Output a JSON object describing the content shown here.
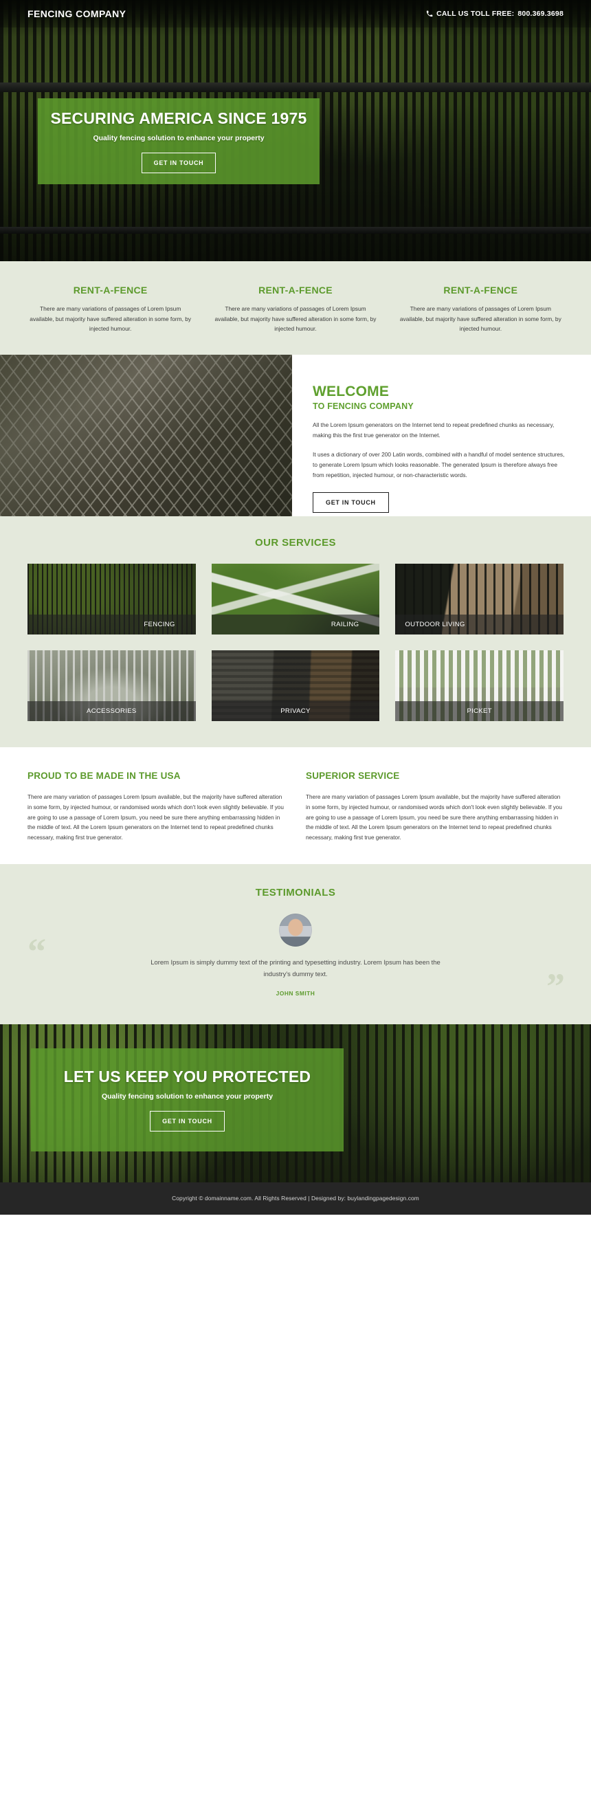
{
  "header": {
    "logo": "FENCING COMPANY",
    "phone_label": "CALL US TOLL FREE:",
    "phone_number": "800.369.3698",
    "phone_icon": "phone-icon"
  },
  "hero": {
    "title": "SECURING AMERICA SINCE 1975",
    "subtitle": "Quality fencing solution to enhance your property",
    "cta_label": "GET IN TOUCH"
  },
  "features": [
    {
      "title": "RENT-A-FENCE",
      "text": "There are many variations of passages of Lorem Ipsum available, but majority have suffered alteration in some form, by injected humour."
    },
    {
      "title": "RENT-A-FENCE",
      "text": "There are many variations of passages of Lorem Ipsum available, but majority have suffered alteration in some form, by injected humour."
    },
    {
      "title": "RENT-A-FENCE",
      "text": "There are many variations of passages of Lorem Ipsum available, but majority have suffered alteration in some form, by injected humour."
    }
  ],
  "welcome": {
    "heading": "WELCOME",
    "subheading": "TO FENCING COMPANY",
    "paragraph1": "All the Lorem Ipsum generators on the Internet tend to repeat predefined chunks as necessary, making this the first true generator on the Internet.",
    "paragraph2": "It uses a dictionary of over 200 Latin words, combined with a handful of model sentence structures, to generate Lorem Ipsum which looks reasonable. The generated Ipsum is therefore always free from repetition, injected humour, or non-characteristic words.",
    "cta_label": "GET IN TOUCH"
  },
  "services": {
    "title": "OUR SERVICES",
    "items": [
      {
        "label": "FENCING",
        "align": "right"
      },
      {
        "label": "RAILING",
        "align": "right"
      },
      {
        "label": "OUTDOOR LIVING",
        "align": "left"
      },
      {
        "label": "ACCESSORIES",
        "align": "center"
      },
      {
        "label": "PRIVACY",
        "align": "center"
      },
      {
        "label": "PICKET",
        "align": "center"
      }
    ]
  },
  "usa": [
    {
      "title": "PROUD TO BE MADE IN THE USA",
      "text": "There are many variation of passages Lorem Ipsum available, but the majority have suffered alteration in some form, by injected humour, or randomised words which don't look even slightly believable. If you are going to use a passage of Lorem Ipsum, you need be sure there anything embarrassing hidden in the middle of text. All the Lorem Ipsum generators on the Internet tend to repeat predefined chunks necessary, making first true generator."
    },
    {
      "title": "SUPERIOR SERVICE",
      "text": "There are many variation of passages Lorem Ipsum available, but the majority have suffered alteration in some form, by injected humour, or randomised words which don't look even slightly believable. If you are going to use a passage of Lorem Ipsum, you need be sure there anything embarrassing hidden in the middle of text. All the Lorem Ipsum generators on the Internet tend to repeat predefined chunks necessary, making first true generator."
    }
  ],
  "testimonials": {
    "title": "TESTIMONIALS",
    "quote": "Lorem Ipsum is simply dummy text of the printing and typesetting industry. Lorem Ipsum has been the industry's dummy text.",
    "author": "JOHN SMITH",
    "quote_open": "“",
    "quote_close": "”"
  },
  "cta": {
    "title": "LET US KEEP YOU PROTECTED",
    "subtitle": "Quality fencing solution to enhance your property",
    "cta_label": "GET IN TOUCH"
  },
  "footer": {
    "text": "Copyright © domainname.com. All Rights Reserved | Designed by: buylandingpagedesign.com"
  },
  "colors": {
    "green": "#5c9a2c",
    "green_text": "#5fa02e",
    "section_bg": "#e4e9dc",
    "footer_bg": "#262626"
  }
}
